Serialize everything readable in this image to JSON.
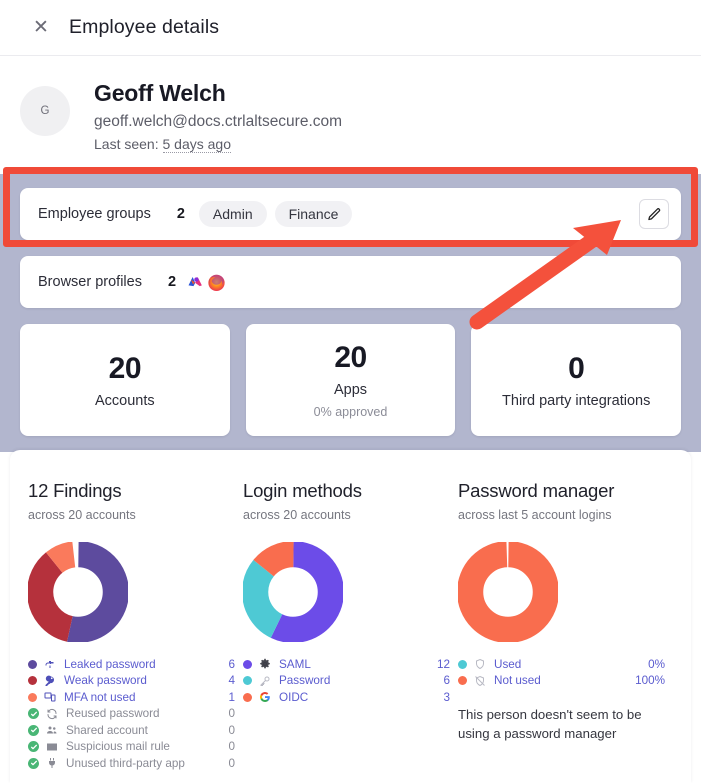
{
  "header": {
    "title": "Employee details",
    "close_icon": "close-icon"
  },
  "identity": {
    "avatar_initial": "G",
    "name": "Geoff Welch",
    "email": "geoff.welch@docs.ctrlaltsecure.com",
    "last_seen_label": "Last seen:",
    "last_seen_value": "5 days ago"
  },
  "groups_row": {
    "label": "Employee groups",
    "count": "2",
    "chips": [
      "Admin",
      "Finance"
    ],
    "edit_icon": "pencil-icon"
  },
  "browser_row": {
    "label": "Browser profiles",
    "count": "2",
    "browsers": [
      "arc-browser-icon",
      "firefox-icon"
    ]
  },
  "tiles": [
    {
      "value": "20",
      "label": "Accounts",
      "sub": ""
    },
    {
      "value": "20",
      "label": "Apps",
      "sub": "0% approved"
    },
    {
      "value": "0",
      "label": "Third party integrations",
      "sub": ""
    }
  ],
  "findings": {
    "title": "12 Findings",
    "subtitle": "across 20 accounts",
    "legend": [
      {
        "label": "Leaked password",
        "value": "6",
        "color": "#5d4b9e",
        "icon": "faucet-icon",
        "zero": false
      },
      {
        "label": "Weak password",
        "value": "4",
        "color": "#b5313c",
        "icon": "key-icon",
        "zero": false
      },
      {
        "label": "MFA not used",
        "value": "1",
        "color": "#fa7a5c",
        "icon": "devices-icon",
        "zero": false
      },
      {
        "label": "Reused password",
        "value": "0",
        "color": "#49b675",
        "icon": "refresh-icon",
        "zero": true
      },
      {
        "label": "Shared account",
        "value": "0",
        "color": "#49b675",
        "icon": "people-icon",
        "zero": true
      },
      {
        "label": "Suspicious mail rule",
        "value": "0",
        "color": "#49b675",
        "icon": "envelope-icon",
        "zero": true
      },
      {
        "label": "Unused third-party app",
        "value": "0",
        "color": "#49b675",
        "icon": "plug-icon",
        "zero": true
      }
    ]
  },
  "login_methods": {
    "title": "Login methods",
    "subtitle": "across 20 accounts",
    "legend": [
      {
        "label": "SAML",
        "value": "12",
        "color": "#6c4ce8",
        "icon": "gear-icon"
      },
      {
        "label": "Password",
        "value": "6",
        "color": "#4ec9d4",
        "icon": "key-icon"
      },
      {
        "label": "OIDC",
        "value": "3",
        "color": "#f96d4e",
        "icon": "google-g-icon"
      }
    ]
  },
  "password_manager": {
    "title": "Password manager",
    "subtitle": "across last 5 account logins",
    "legend": [
      {
        "label": "Used",
        "value": "0%",
        "color": "#4ec9d4",
        "icon": "shield-icon"
      },
      {
        "label": "Not used",
        "value": "100%",
        "color": "#f96d4e",
        "icon": "shield-off-icon"
      }
    ],
    "note": "This person doesn't seem to be using a password manager"
  },
  "chart_data": [
    {
      "type": "pie",
      "title": "12 Findings",
      "subtitle": "across 20 accounts",
      "categories": [
        "Leaked password",
        "Weak password",
        "MFA not used",
        "Reused password",
        "Shared account",
        "Suspicious mail rule",
        "Unused third-party app"
      ],
      "values": [
        6,
        4,
        1,
        0,
        0,
        0,
        0
      ],
      "colors": [
        "#5d4b9e",
        "#b5313c",
        "#fa7a5c",
        "#49b675",
        "#49b675",
        "#49b675",
        "#49b675"
      ],
      "legend_position": "bottom",
      "donut": true
    },
    {
      "type": "pie",
      "title": "Login methods",
      "subtitle": "across 20 accounts",
      "categories": [
        "SAML",
        "Password",
        "OIDC"
      ],
      "values": [
        12,
        6,
        3
      ],
      "colors": [
        "#6c4ce8",
        "#4ec9d4",
        "#f96d4e"
      ],
      "legend_position": "bottom",
      "donut": true
    },
    {
      "type": "pie",
      "title": "Password manager",
      "subtitle": "across last 5 account logins",
      "categories": [
        "Used",
        "Not used"
      ],
      "values": [
        0,
        100
      ],
      "unit": "%",
      "colors": [
        "#4ec9d4",
        "#f96d4e"
      ],
      "legend_position": "bottom",
      "donut": true
    }
  ],
  "annotations": {
    "highlight_color": "#f04a38",
    "arrow_color": "#f4513c",
    "target": "groups-edit-button"
  }
}
